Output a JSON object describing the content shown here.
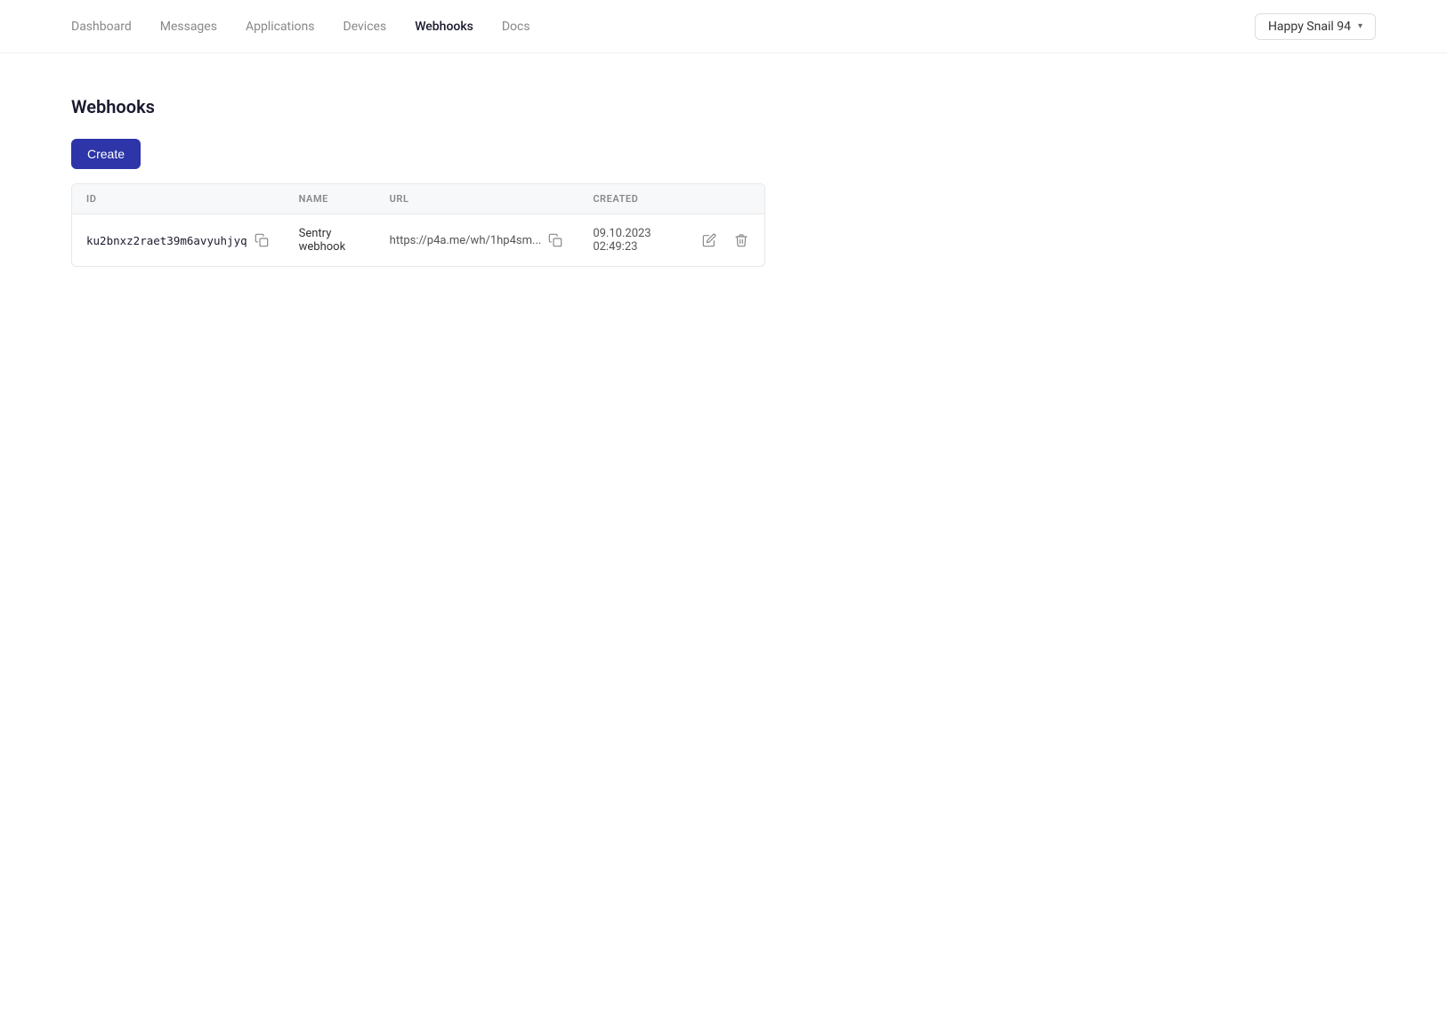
{
  "nav": {
    "links": [
      {
        "label": "Dashboard",
        "active": false
      },
      {
        "label": "Messages",
        "active": false
      },
      {
        "label": "Applications",
        "active": false
      },
      {
        "label": "Devices",
        "active": false
      },
      {
        "label": "Webhooks",
        "active": true
      },
      {
        "label": "Docs",
        "active": false
      }
    ],
    "user": {
      "name": "Happy Snail 94"
    }
  },
  "page": {
    "title": "Webhooks",
    "create_button_label": "Create"
  },
  "table": {
    "headers": [
      "ID",
      "NAME",
      "URL",
      "CREATED"
    ],
    "rows": [
      {
        "id": "ku2bnxz2raet39m6avyuhjyq",
        "name": "Sentry webhook",
        "url": "https://p4a.me/wh/1hp4sm...",
        "created": "09.10.2023 02:49:23"
      }
    ]
  }
}
